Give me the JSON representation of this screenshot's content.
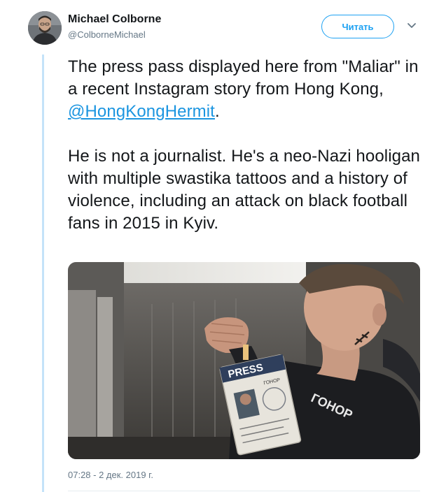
{
  "author": {
    "name": "Michael Colborne",
    "handle": "@ColborneMichael"
  },
  "follow_button": {
    "label": "Читать"
  },
  "tweet": {
    "para1_before": "The press pass displayed here from \"Maliar\" in a recent Instagram story from Hong Kong, ",
    "mention": "@HongKongHermit",
    "para1_after": ".",
    "para2": "He is not a journalist. He's a neo-Nazi hooligan with multiple swastika tattoos and a history of violence, including an attack on black football fans in 2015 in Kyiv."
  },
  "media": {
    "badge_text": "PRESS",
    "card_text": "ГОНОР",
    "hoodie_text": "ГОНОР"
  },
  "timestamp": "07:28 - 2 дек. 2019 г.",
  "colors": {
    "accent": "#1da1f2",
    "link": "#1b95e0",
    "thread_line": "#c4e3f9",
    "muted": "#657786"
  }
}
